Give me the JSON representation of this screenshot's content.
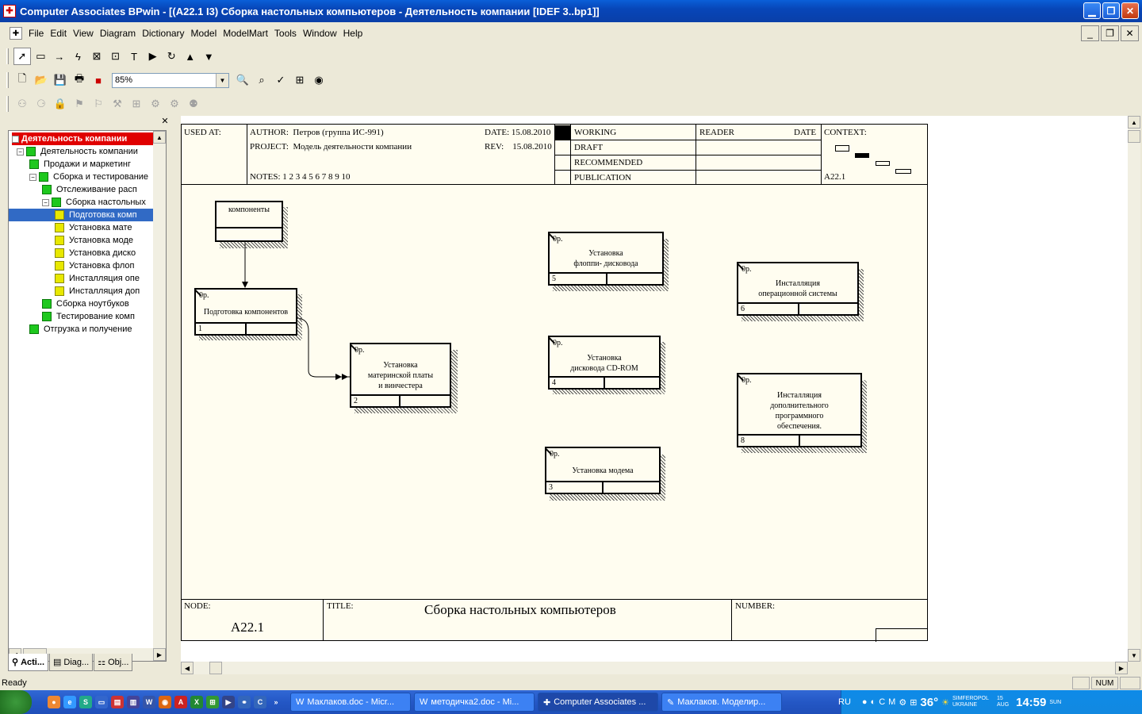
{
  "window": {
    "title": "Computer Associates BPwin - [(A22.1 I3) Сборка настольных  компьютеров - Деятельность компании  [IDEF 3..bp1]]"
  },
  "menu": [
    "File",
    "Edit",
    "View",
    "Diagram",
    "Dictionary",
    "Model",
    "ModelMart",
    "Tools",
    "Window",
    "Help"
  ],
  "toolbar": {
    "zoom": "85%"
  },
  "tree": {
    "root": "Деятельность компании",
    "items": [
      {
        "label": "Деятельность компании"
      },
      {
        "label": "Продажи и маркетинг"
      },
      {
        "label": "Сборка и тестирование"
      },
      {
        "label": "Отслеживание расп"
      },
      {
        "label": "Сборка настольных"
      },
      {
        "label": "Подготовка комп"
      },
      {
        "label": "Установка мате"
      },
      {
        "label": "Установка моде"
      },
      {
        "label": "Установка диско"
      },
      {
        "label": "Установка флоп"
      },
      {
        "label": "Инсталляция опе"
      },
      {
        "label": "Инсталляция доп"
      },
      {
        "label": "Сборка ноутбуков"
      },
      {
        "label": "Тестирование комп"
      },
      {
        "label": "Отгрузка и получение"
      }
    ],
    "tabs": [
      "Acti...",
      "Diag...",
      "Obj..."
    ]
  },
  "diagram": {
    "header": {
      "used_at": "USED AT:",
      "author_label": "AUTHOR:",
      "author": "Петров (группа ИС-991)",
      "project_label": "PROJECT:",
      "project": "Модель деятельности компании",
      "date_label": "DATE:",
      "date": "15.08.2010",
      "rev_label": "REV:",
      "rev": "15.08.2010",
      "notes": "NOTES:  1  2  3  4  5  6  7  8  9  10",
      "working": "WORKING",
      "draft": "DRAFT",
      "recommended": "RECOMMENDED",
      "publication": "PUBLICATION",
      "reader": "READER",
      "date2": "DATE",
      "context": "CONTEXT:",
      "context_node": "A22.1"
    },
    "footer": {
      "node_label": "NODE:",
      "node": "A22.1",
      "title_label": "TITLE:",
      "title": "Сборка настольных  компьютеров",
      "number_label": "NUMBER:"
    },
    "referent": {
      "name": "компоненты"
    },
    "blocks": [
      {
        "num": "1",
        "op": "0р.",
        "lines": [
          "Подготовка компонентов"
        ]
      },
      {
        "num": "2",
        "op": "0р.",
        "lines": [
          "Установка",
          "материнской платы",
          "и винчестера"
        ]
      },
      {
        "num": "3",
        "op": "0р.",
        "lines": [
          "Установка модема"
        ]
      },
      {
        "num": "4",
        "op": "0р.",
        "lines": [
          "Установка",
          "дисковода CD-ROM"
        ]
      },
      {
        "num": "5",
        "op": "0р.",
        "lines": [
          "Установка",
          "флоппи- дисковода"
        ]
      },
      {
        "num": "6",
        "op": "0р.",
        "lines": [
          "Инсталляция",
          "операционной системы"
        ]
      },
      {
        "num": "8",
        "op": "0р.",
        "lines": [
          "Инсталляция",
          "дополнительного",
          "программного",
          "обеспечения."
        ]
      }
    ]
  },
  "status": {
    "text": "Ready",
    "num": "NUM"
  },
  "taskbar": {
    "tasks": [
      "Маклаков.doc - Micr...",
      "методичка2.doc - Mi...",
      "Computer Associates ...",
      "Маклаков. Моделир..."
    ],
    "lang": "RU",
    "temp": "36°",
    "location": "SIMFEROPOL UKRAINE",
    "date": "15 AUG",
    "time": "14:59",
    "day": "SUN"
  }
}
